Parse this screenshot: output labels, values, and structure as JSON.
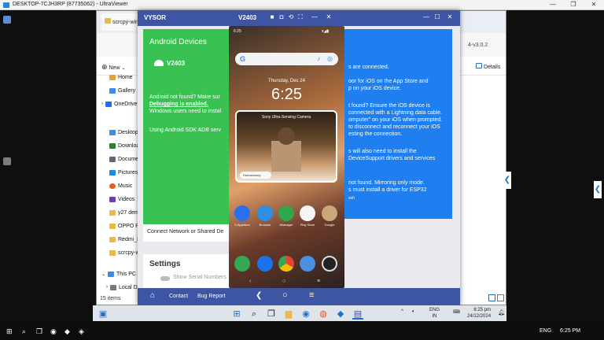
{
  "ultraviewer": {
    "title": "DESKTOP-7CJH3RP (87735062) - UltraViewer",
    "minimize": "—",
    "maximize": "❐",
    "close": "✕"
  },
  "explorer": {
    "tab_label": "scrcpy-win",
    "new_label": "New",
    "details_label": "Details",
    "path_fragment": "4-v3.0.2",
    "sidebar": [
      {
        "label": "Home",
        "color": "#f0a030"
      },
      {
        "label": "Gallery",
        "color": "#3a8ee6"
      },
      {
        "label": "OneDrive",
        "color": "#1a73e8"
      },
      {
        "label": "Desktop",
        "color": "#3a8ee6"
      },
      {
        "label": "Downloa",
        "color": "#2e7d32"
      },
      {
        "label": "Docume",
        "color": "#5a6b7d"
      },
      {
        "label": "Pictures",
        "color": "#1e88e5"
      },
      {
        "label": "Music",
        "color": "#e65a1a"
      },
      {
        "label": "Videos",
        "color": "#6a3fb5"
      },
      {
        "label": "y27 demo",
        "color": "#e9b949"
      },
      {
        "label": "OPPO Pe",
        "color": "#e9b949"
      },
      {
        "label": "Redmi_N",
        "color": "#e9b949"
      },
      {
        "label": "scrcpy-w",
        "color": "#e9b949"
      },
      {
        "label": "This PC",
        "color": "#3a8ee6"
      },
      {
        "label": "Local D",
        "color": "#6b7b8a"
      }
    ],
    "status": "15 items"
  },
  "vysor": {
    "title": "VYSOR",
    "device_title": "V2403",
    "android_heading": "Android Devices",
    "device_name": "V2403",
    "android_text": [
      "Android not found? Make sur",
      "Debugging is enabled.",
      "Windows users need to instal",
      "",
      "Using Android SDK ADB serv"
    ],
    "ios_text": [
      "s are connected.",
      "",
      "oor for iOS on the App Store and",
      "p on your iOS device.",
      "",
      "t found? Ensure the iOS device is",
      "connected with a Lightning data cable.",
      "omputer\" on your iOS when prompted.",
      "to disconnect and reconnect your iOS",
      "esting the connection.",
      "",
      "s will also need to install the",
      "DeviceSupport drivers and services",
      "",
      "",
      "not found. Mirroring only mode.",
      "s must install a driver for ESP32",
      "esh"
    ],
    "connect_text": "Connect Network or Shared De",
    "settings_heading": "Settings",
    "show_serial": "Show Serial Numbers",
    "bottom": {
      "contact": "Contact",
      "bug_report": "Bug Report"
    }
  },
  "phone": {
    "status_time": "6:25",
    "lock_date": "Thursday, Dec 24",
    "lock_time": "6:25",
    "card_title": "Sony Ultra-Sensing Camera",
    "card_badge": "Humanmacy",
    "apps": [
      {
        "label": "V-Appstore",
        "color": "#2c6ef2"
      },
      {
        "label": "Browser",
        "color": "#2f8ee6"
      },
      {
        "label": "iManager",
        "color": "#2ea84b"
      },
      {
        "label": "Play Store",
        "color": "#f5f5f5"
      },
      {
        "label": "Google",
        "color": "#c9a77a"
      }
    ]
  },
  "taskbar": {
    "lang": "ENG",
    "lang_region": "IN",
    "lang_right": "ENG",
    "time": "6:25 pm",
    "date": "24/12/2024",
    "time_right": "6:25 PM"
  }
}
